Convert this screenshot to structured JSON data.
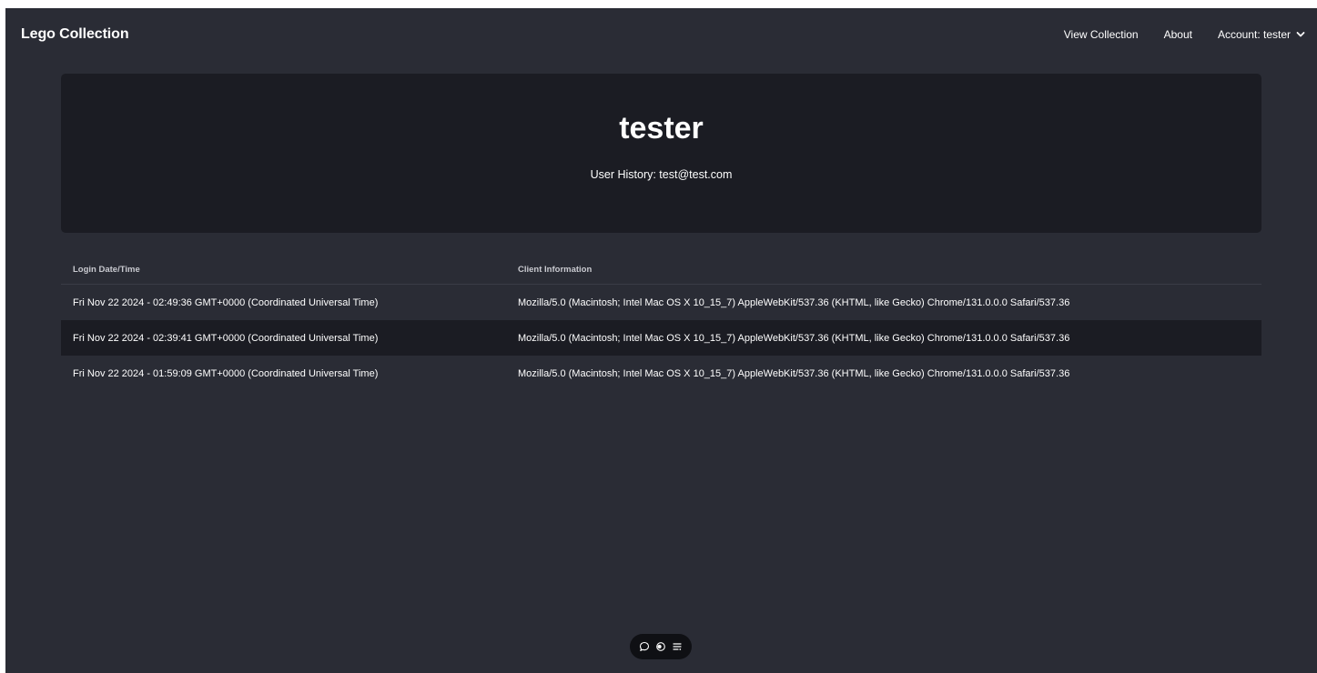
{
  "navbar": {
    "brand": "Lego Collection",
    "links": {
      "view_collection": "View Collection",
      "about": "About",
      "account": "Account: tester"
    }
  },
  "hero": {
    "title": "tester",
    "subtitle": "User History: test@test.com"
  },
  "table": {
    "headers": {
      "date": "Login Date/Time",
      "client": "Client Information"
    },
    "rows": [
      {
        "date": "Fri Nov 22 2024 - 02:49:36 GMT+0000 (Coordinated Universal Time)",
        "client": "Mozilla/5.0 (Macintosh; Intel Mac OS X 10_15_7) AppleWebKit/537.36 (KHTML, like Gecko) Chrome/131.0.0.0 Safari/537.36"
      },
      {
        "date": "Fri Nov 22 2024 - 02:39:41 GMT+0000 (Coordinated Universal Time)",
        "client": "Mozilla/5.0 (Macintosh; Intel Mac OS X 10_15_7) AppleWebKit/537.36 (KHTML, like Gecko) Chrome/131.0.0.0 Safari/537.36"
      },
      {
        "date": "Fri Nov 22 2024 - 01:59:09 GMT+0000 (Coordinated Universal Time)",
        "client": "Mozilla/5.0 (Macintosh; Intel Mac OS X 10_15_7) AppleWebKit/537.36 (KHTML, like Gecko) Chrome/131.0.0.0 Safari/537.36"
      }
    ]
  },
  "toolbar": {
    "icons": [
      "comment-icon",
      "toggle-icon",
      "menu-lines-icon"
    ]
  },
  "colors": {
    "background": "#2a2c35",
    "panel": "#1b1c23",
    "text": "#ffffff",
    "muted_text": "#c9cad0"
  }
}
